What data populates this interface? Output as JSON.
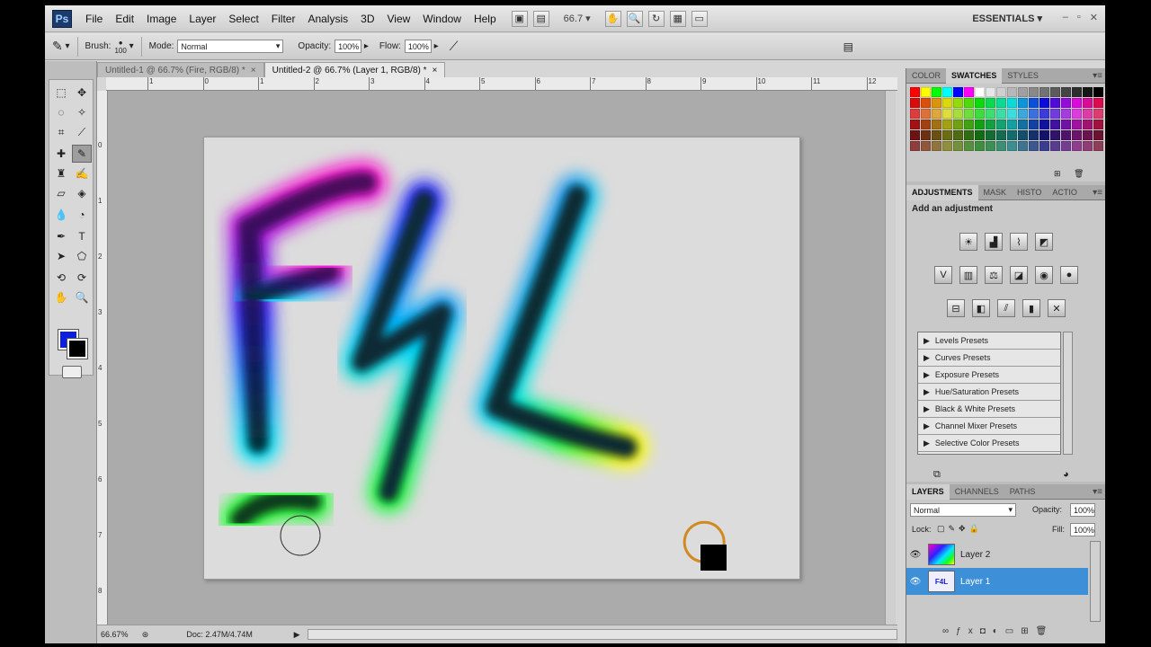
{
  "app": {
    "logo": "Ps",
    "workspace": "ESSENTIALS",
    "zoom": "66.7"
  },
  "menu": [
    "File",
    "Edit",
    "Image",
    "Layer",
    "Select",
    "Filter",
    "Analysis",
    "3D",
    "View",
    "Window",
    "Help"
  ],
  "options": {
    "brush_label": "Brush:",
    "brush_size": "100",
    "mode_label": "Mode:",
    "mode_value": "Normal",
    "opacity_label": "Opacity:",
    "opacity_value": "100%",
    "flow_label": "Flow:",
    "flow_value": "100%"
  },
  "tabs": [
    {
      "label": "Untitled-1 @ 66.7% (Fire, RGB/8) *",
      "close": "×"
    },
    {
      "label": "Untitled-2 @ 66.7% (Layer 1, RGB/8) *",
      "close": "×"
    }
  ],
  "ruler_h": [
    "1",
    "0",
    "1",
    "2",
    "3",
    "4",
    "5",
    "6",
    "7",
    "8",
    "9",
    "10",
    "11",
    "12"
  ],
  "ruler_v": [
    "0",
    "1",
    "2",
    "3",
    "4",
    "5",
    "6",
    "7",
    "8"
  ],
  "colors": {
    "foreground": "#0c1ee0",
    "background": "#000000",
    "selected_layer": "#3d8fd8"
  },
  "status": {
    "zoom": "66.67%",
    "doc": "Doc: 2.47M/4.74M"
  },
  "panels": {
    "swatch_tabs": [
      "COLOR",
      "SWATCHES",
      "STYLES"
    ],
    "adjust_tabs": [
      "ADJUSTMENTS",
      "MASK",
      "HISTO",
      "ACTIO"
    ],
    "adjust_title": "Add an adjustment",
    "presets": [
      "Levels Presets",
      "Curves Presets",
      "Exposure Presets",
      "Hue/Saturation Presets",
      "Black & White Presets",
      "Channel Mixer Presets",
      "Selective Color Presets"
    ],
    "layer_tabs": [
      "LAYERS",
      "CHANNELS",
      "PATHS"
    ],
    "blend_mode": "Normal",
    "opacity_label": "Opacity:",
    "opacity_value": "100%",
    "lock_label": "Lock:",
    "fill_label": "Fill:",
    "fill_value": "100%",
    "layers": [
      {
        "name": "Layer 2",
        "selected": false
      },
      {
        "name": "Layer 1",
        "selected": true
      }
    ]
  }
}
